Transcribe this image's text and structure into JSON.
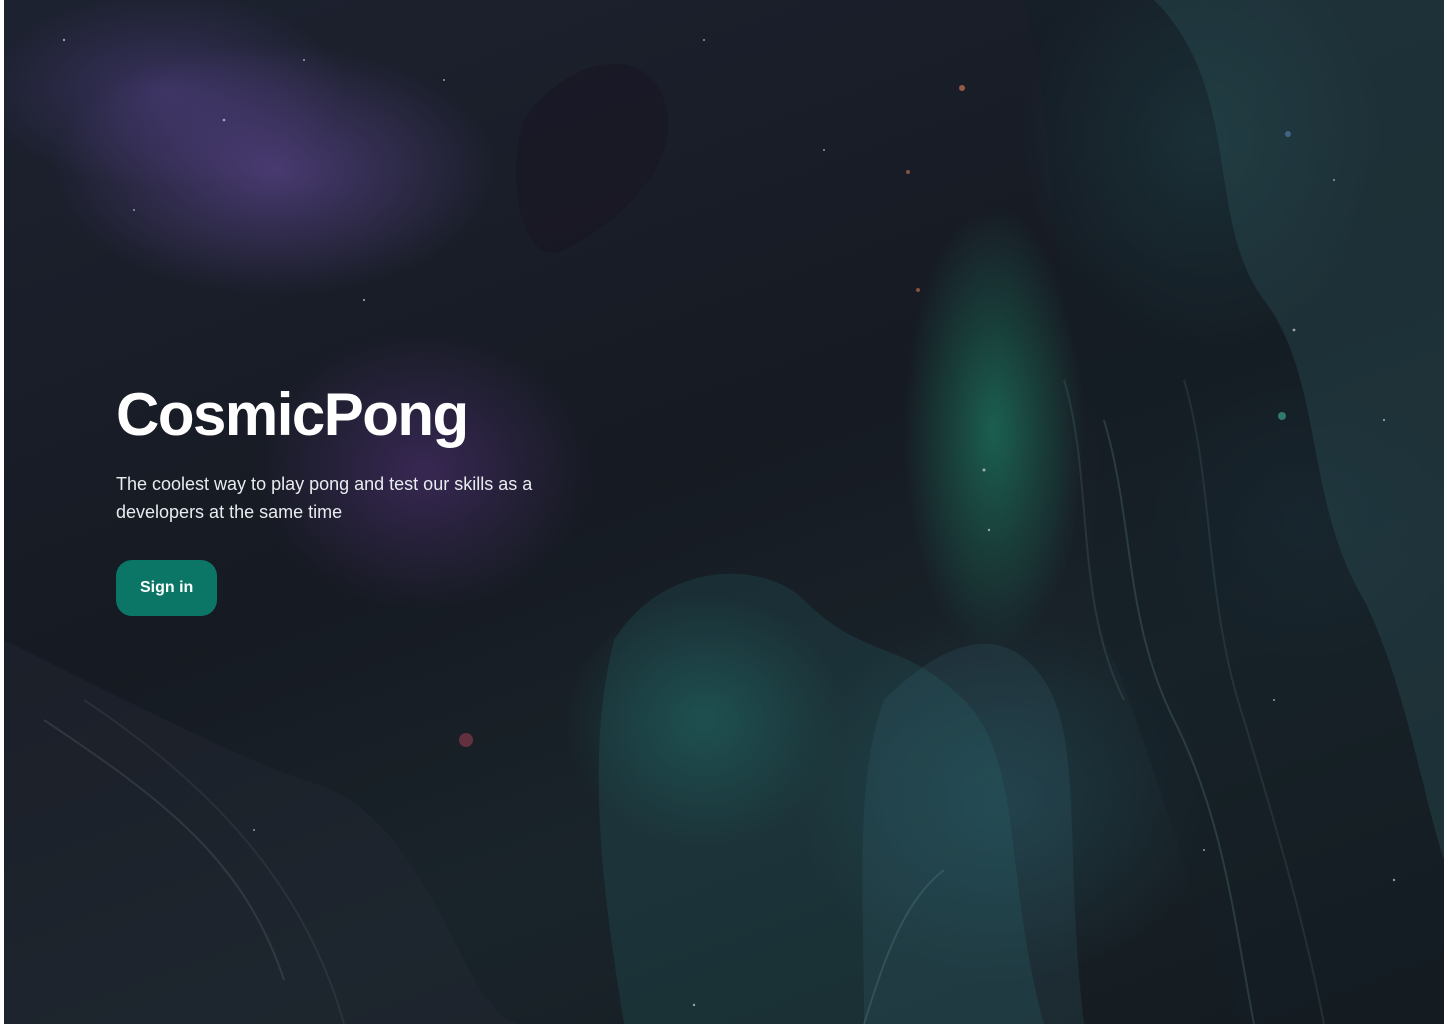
{
  "hero": {
    "title": "CosmicPong",
    "subtitle": "The coolest way to play pong and test our skills as a developers at the same time",
    "signin_label": "Sign in"
  },
  "colors": {
    "background": "#171b22",
    "button": "#0b7566",
    "title": "#ffffff",
    "subtitle": "#e8ecef",
    "nebula_purple": "#6e50aa",
    "nebula_green": "#1e9673"
  }
}
